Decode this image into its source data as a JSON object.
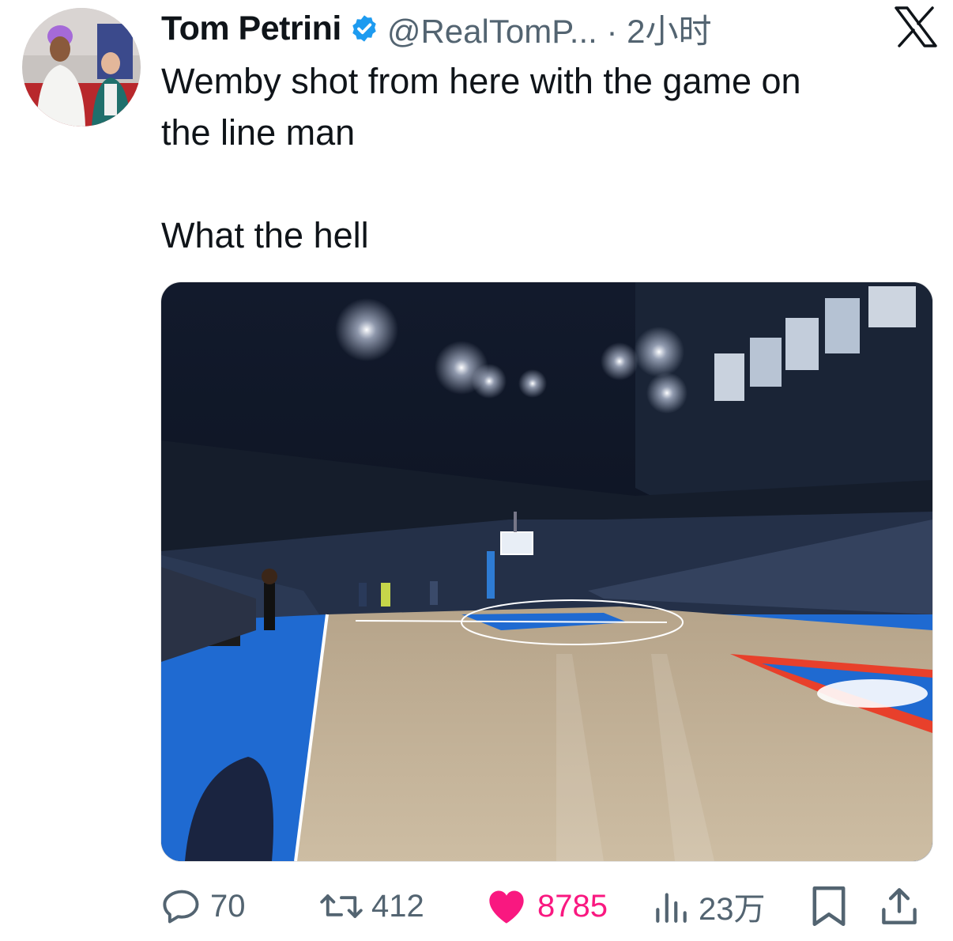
{
  "tweet": {
    "author_name": "Tom Petrini",
    "handle_time": "@RealTomP... · 2小时",
    "text_lines": [
      "Wemby shot from here with the game on",
      "the line man",
      "What the hell"
    ]
  },
  "actions": {
    "replies": "70",
    "retweets": "412",
    "likes": "8785",
    "views": "23万"
  },
  "icons": {
    "verified": "verified-badge-icon",
    "platform": "x-logo-icon",
    "reply": "reply-icon",
    "retweet": "retweet-icon",
    "like": "heart-icon",
    "views": "views-icon",
    "bookmark": "bookmark-icon",
    "share": "share-icon"
  },
  "colors": {
    "like_active": "#f91880",
    "verified": "#1d9bf0",
    "text_secondary": "#536471"
  }
}
